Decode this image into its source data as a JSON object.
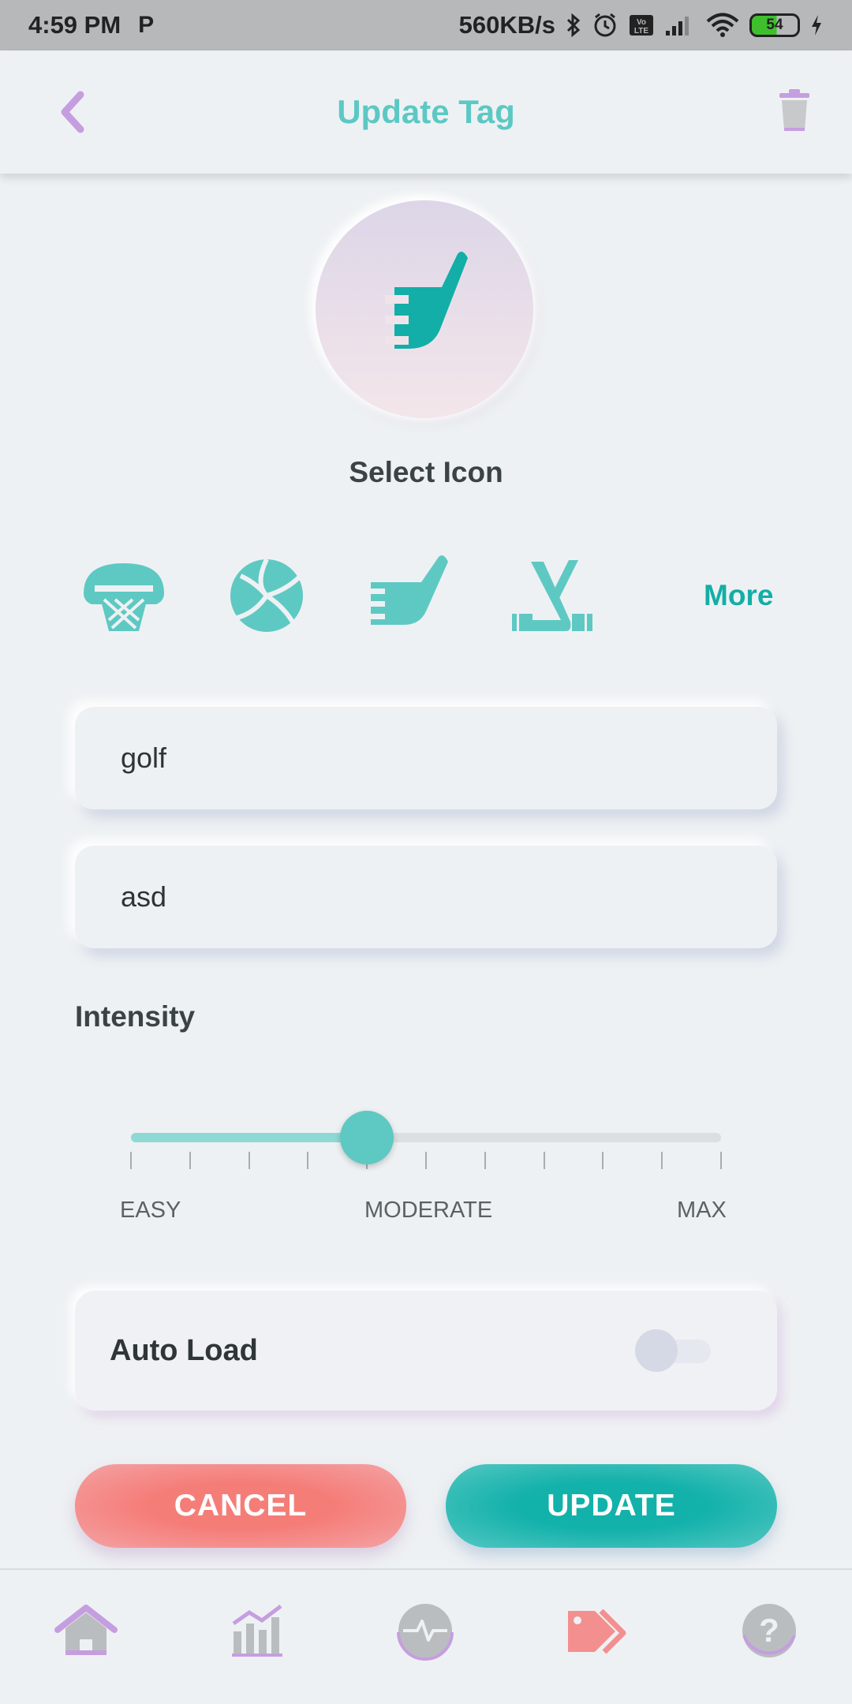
{
  "status_bar": {
    "time": "4:59 PM",
    "carrier_icon": "p-icon",
    "network_speed": "560KB/s",
    "battery_level": "54"
  },
  "app_bar": {
    "title": "Update Tag",
    "back_icon": "chevron-left-icon",
    "delete_icon": "trash-icon"
  },
  "selected_icon": "golf-club-icon",
  "select_icon_label": "Select Icon",
  "icon_options": [
    "basketball-hoop-icon",
    "volleyball-icon",
    "golf-club-icon",
    "hockey-sticks-icon"
  ],
  "more_label": "More",
  "fields": {
    "name_value": "golf",
    "description_value": "asd"
  },
  "intensity": {
    "label": "Intensity",
    "value_fraction": 0.4,
    "tick_count": 11,
    "labels": {
      "easy": "EASY",
      "moderate": "MODERATE",
      "max": "MAX"
    }
  },
  "auto_load": {
    "label": "Auto Load",
    "enabled": false
  },
  "buttons": {
    "cancel": "CANCEL",
    "update": "UPDATE"
  },
  "bottom_nav": [
    "home-icon",
    "chart-icon",
    "heartbeat-icon",
    "tags-icon",
    "help-icon"
  ],
  "colors": {
    "accent_teal": "#12aea7",
    "title_teal": "#5cc8c4",
    "cancel_red": "#f57d78",
    "icon_purple": "#c59ee0",
    "active_pink": "#f48f8f",
    "background": "#eef1f3"
  }
}
